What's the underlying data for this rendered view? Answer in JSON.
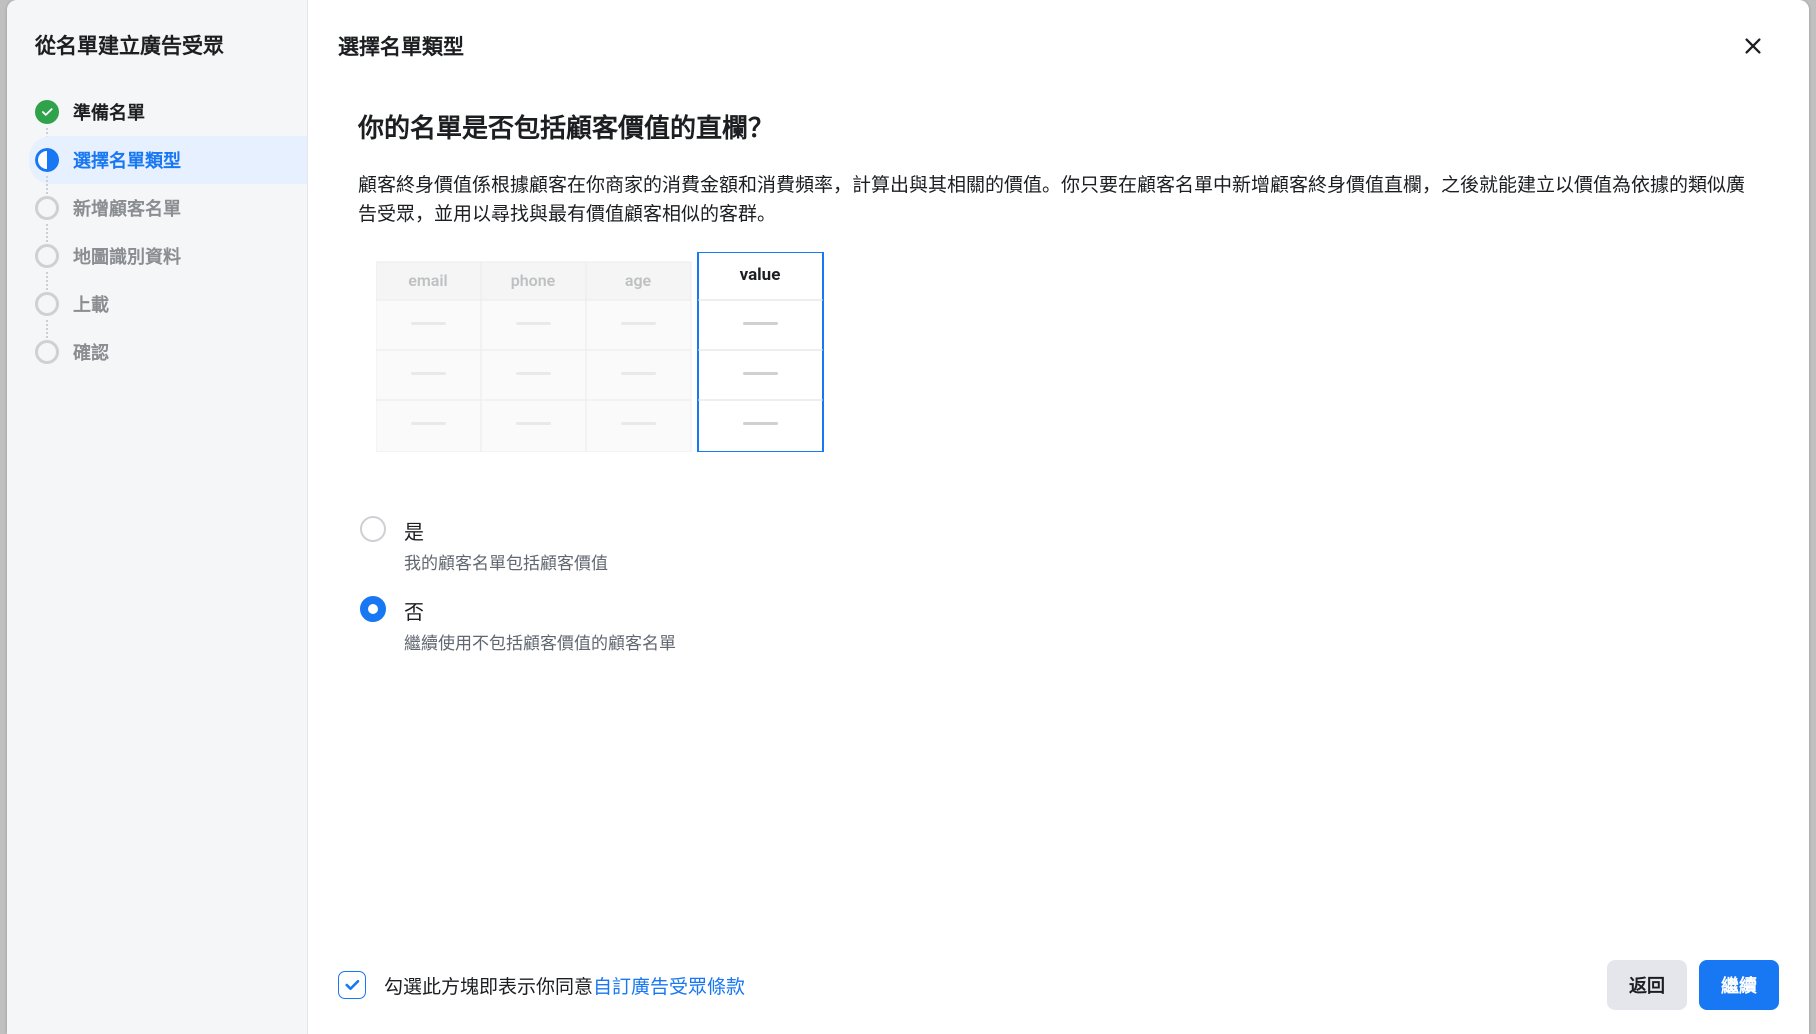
{
  "sidebar": {
    "title": "從名單建立廣告受眾",
    "steps": [
      {
        "label": "準備名單",
        "status": "completed"
      },
      {
        "label": "選擇名單類型",
        "status": "current"
      },
      {
        "label": "新增顧客名單",
        "status": "pending"
      },
      {
        "label": "地圖識別資料",
        "status": "pending"
      },
      {
        "label": "上載",
        "status": "pending"
      },
      {
        "label": "確認",
        "status": "pending"
      }
    ]
  },
  "header": {
    "title": "選擇名單類型"
  },
  "content": {
    "heading": "你的名單是否包括顧客價值的直欄？",
    "description": "顧客終身價值係根據顧客在你商家的消費金額和消費頻率，計算出與其相關的價值。你只要在顧客名單中新增顧客終身價值直欄，之後就能建立以價值為依據的類似廣告受眾，並用以尋找與最有價值顧客相似的客群。",
    "illustration": {
      "columns": [
        "email",
        "phone",
        "age",
        "value"
      ]
    },
    "options": [
      {
        "label": "是",
        "description": "我的顧客名單包括顧客價值",
        "selected": false
      },
      {
        "label": "否",
        "description": "繼續使用不包括顧客價值的顧客名單",
        "selected": true
      }
    ]
  },
  "footer": {
    "checkbox_checked": true,
    "agreement_text": "勾選此方塊即表示你同意",
    "agreement_link": "自訂廣告受眾條款",
    "back_button": "返回",
    "continue_button": "繼續"
  }
}
